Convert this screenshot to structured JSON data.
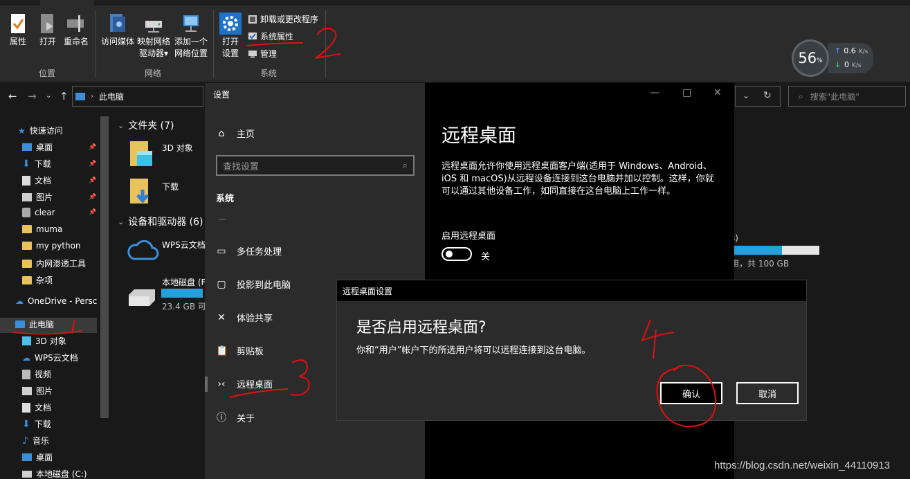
{
  "ribbon": {
    "buttons": {
      "properties": "属性",
      "open": "打开",
      "rename": "重命名",
      "access_media": "访问媒体",
      "map_drive_line1": "映射网络",
      "map_drive_line2": "驱动器",
      "add_location_line1": "添加一个",
      "add_location_line2": "网络位置",
      "open_settings_line1": "打开",
      "open_settings_line2": "设置",
      "uninstall": "卸载或更改程序",
      "system_properties": "系统属性",
      "manage": "管理"
    },
    "groups": {
      "location": "位置",
      "network": "网络",
      "system": "系统"
    }
  },
  "net_widget": {
    "percent": "56",
    "percent_unit": "%",
    "upload": "0.6",
    "download": "0",
    "unit": "K/s"
  },
  "address": {
    "path": "此电脑",
    "search_placeholder": "搜索\"此电脑\""
  },
  "nav": {
    "quick_access": "快速访问",
    "items": [
      {
        "label": "桌面"
      },
      {
        "label": "下载"
      },
      {
        "label": "文档"
      },
      {
        "label": "图片"
      },
      {
        "label": "clear"
      },
      {
        "label": "muma"
      },
      {
        "label": "my python"
      },
      {
        "label": "内网渗透工具"
      },
      {
        "label": "杂项"
      }
    ],
    "onedrive": "OneDrive - Persc",
    "this_pc": "此电脑",
    "pc_items": [
      {
        "label": "3D 对象"
      },
      {
        "label": "WPS云文档"
      },
      {
        "label": "视频"
      },
      {
        "label": "图片"
      },
      {
        "label": "文档"
      },
      {
        "label": "下载"
      },
      {
        "label": "音乐"
      },
      {
        "label": "桌面"
      },
      {
        "label": "本地磁盘 (C:)"
      }
    ]
  },
  "files": {
    "folders_header": "文件夹 (7)",
    "folder_3d": "3D 对象",
    "folder_download": "下载",
    "devices_header": "设备和驱动器 (6)",
    "wps_cloud": "WPS云文档",
    "local_disk": "本地磁盘 (F",
    "local_disk_size": "23.4 GB 可",
    "local_disk_fill_pct": 100,
    "other_disk_label_frag": "s)",
    "other_disk_size": "用，共 100 GB",
    "other_disk_fill_pct": 58
  },
  "settings": {
    "title": "设置",
    "home": "主页",
    "search_placeholder": "查找设置",
    "section": "系统",
    "nav_items": [
      "多任务处理",
      "投影到此电脑",
      "体验共享",
      "剪贴板",
      "远程桌面",
      "关于"
    ],
    "page_title": "远程桌面",
    "description": "远程桌面允许你使用远程桌面客户端(适用于 Windows、Android、iOS 和 macOS)从远程设备连接到这台电脑并加以控制。这样，你就可以通过其他设备工作，如同直接在这台电脑上工作一样。",
    "enable_label": "启用远程桌面",
    "toggle_state": "关"
  },
  "dialog": {
    "title": "远程桌面设置",
    "heading": "是否启用远程桌面?",
    "body": "你和“用户”帐户下的所选用户将可以远程连接到这台电脑。",
    "confirm": "确认",
    "cancel": "取消"
  },
  "watermark": "https://blog.csdn.net/weixin_44110913"
}
